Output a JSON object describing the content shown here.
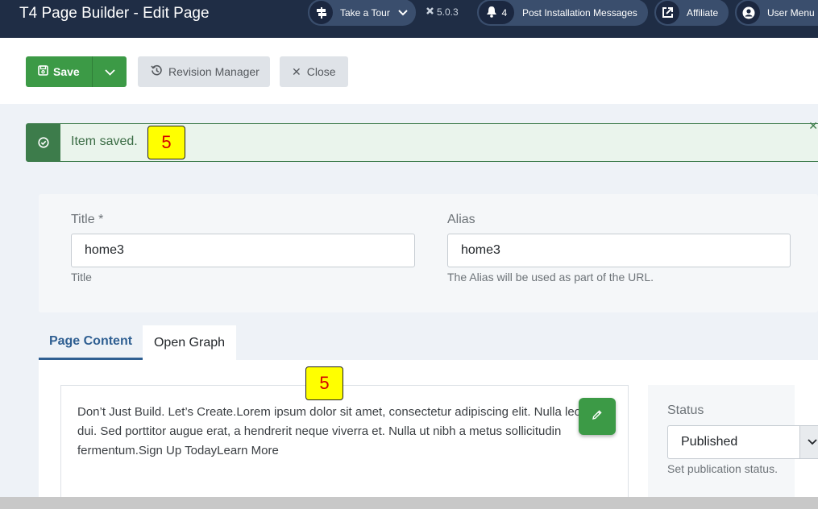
{
  "header": {
    "title": "T4 Page Builder - Edit Page",
    "tour_label": "Take a Tour",
    "version": "5.0.3",
    "notification_count": "4",
    "messages_label": "Post Installation Messages",
    "affiliate_label": "Affiliate",
    "user_menu_label": "User Menu"
  },
  "toolbar": {
    "save_label": "Save",
    "revision_label": "Revision Manager",
    "close_label": "Close"
  },
  "alert": {
    "message": "Item saved."
  },
  "badges": {
    "first": "5",
    "second": "5"
  },
  "form": {
    "title_label": "Title *",
    "title_value": "home3",
    "title_hint": "Title",
    "alias_label": "Alias",
    "alias_value": "home3",
    "alias_hint": "The Alias will be used as part of the URL."
  },
  "tabs": [
    {
      "label": "Page Content"
    },
    {
      "label": "Open Graph"
    }
  ],
  "editor": {
    "content": "Don’t Just Build. Let’s Create.Lorem ipsum dolor sit amet, consectetur adipiscing elit. Nulla leo dui. Sed porttitor augue erat, a hendrerit neque viverra et. Nulla ut nibh a metus sollicitudin fermentum.Sign Up TodayLearn More"
  },
  "status": {
    "label": "Status",
    "value": "Published",
    "hint": "Set publication status."
  },
  "colors": {
    "header_bg": "#1f2d45",
    "success": "#3c9a46",
    "alert_border": "#3d7c4b",
    "tab_active": "#2f5f92"
  }
}
